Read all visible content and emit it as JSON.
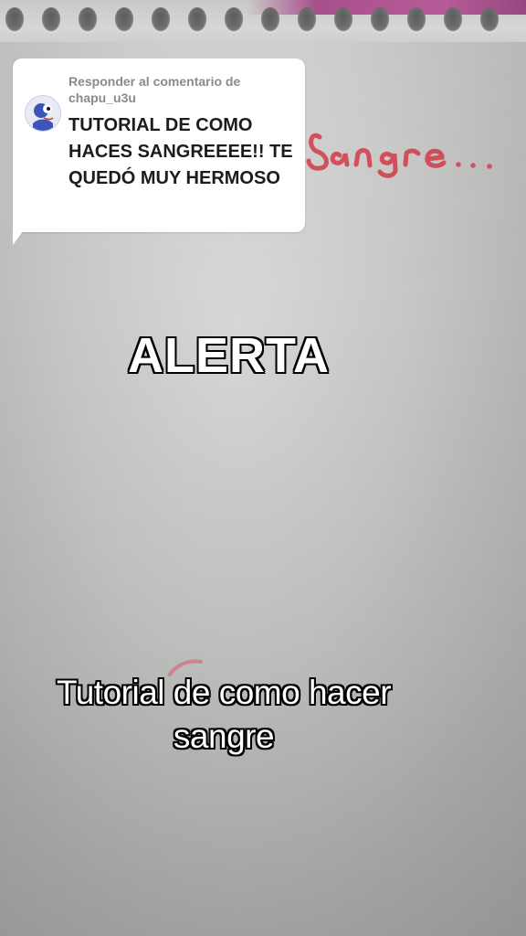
{
  "comment": {
    "reply_label": "Responder al comentario de chapu_u3u",
    "text": "TUTORIAL DE COMO HACES SANGREEEE!! TE QUEDÓ MUY HERMOSO"
  },
  "overlay": {
    "headline": "ALERTA",
    "caption": "Tutorial de como hacer sangre"
  },
  "handwriting": {
    "word": "Sangre..."
  },
  "colors": {
    "bubble_bg": "#ffffff",
    "blood_red": "#d23a4a",
    "overlay_text": "#ffffff",
    "overlay_outline": "#000000"
  },
  "icons": {
    "avatar": "avatar-image"
  }
}
